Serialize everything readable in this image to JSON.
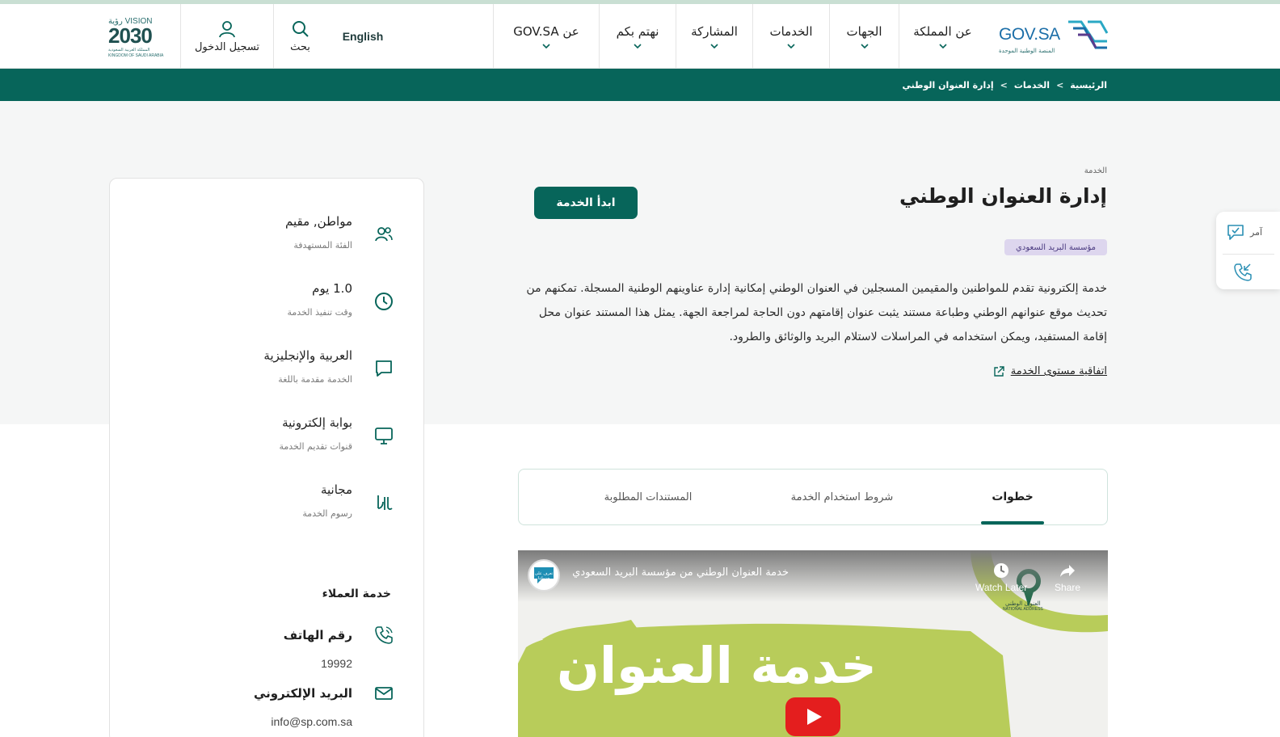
{
  "header": {
    "logo_text": "GOV.SA",
    "logo_subtitle": "المنصة الوطنية الموحدة",
    "nav": [
      {
        "label": "عن المملكة"
      },
      {
        "label": "الجهات"
      },
      {
        "label": "الخدمات"
      },
      {
        "label": "المشاركة"
      },
      {
        "label": "نهتم بكم"
      },
      {
        "label": "عن GOV.SA"
      }
    ],
    "language_label": "English",
    "search_label": "بحث",
    "login_label": "تسجيل الدخول",
    "vision_title": "VISION رؤية",
    "vision_year": "2030",
    "vision_sub": "المملكة العربية السعودية",
    "vision_sub_en": "KINGDOM OF SAUDI ARABIA"
  },
  "breadcrumb": {
    "items": [
      "الرئيسية",
      "الخدمات",
      "إدارة العنوان الوطني"
    ],
    "separator": ">"
  },
  "service": {
    "kicker": "الخدمة",
    "title": "إدارة العنوان الوطني",
    "start_button": "ابدأ الخدمة",
    "agency": "مؤسسة البريد السعودي",
    "description": "خدمة إلكترونية تقدم للمواطنين والمقيمين المسجلين في العنوان الوطني إمكانية إدارة عناوينهم الوطنية المسجلة. تمكنهم من تحديث موقع عنوانهم الوطني وطباعة مستند يثبت عنوان إقامتهم دون الحاجة لمراجعة الجهة. يمثل هذا المستند عنوان محل إقامة المستفيد، ويمكن استخدامه في المراسلات لاستلام البريد والوثائق والطرود.",
    "sla_link": "اتفاقية مستوى الخدمة"
  },
  "info": [
    {
      "value": "مواطن, مقيم",
      "caption": "الفئة المستهدفة",
      "icon": "users-icon"
    },
    {
      "value": "1.0 يوم",
      "caption": "وقت تنفيذ الخدمة",
      "icon": "clock-icon"
    },
    {
      "value": "العربية والإنجليزية",
      "caption": "الخدمة مقدمة باللغة",
      "icon": "chat-bubble-icon"
    },
    {
      "value": "بوابة إلكترونية",
      "caption": "قنوات تقديم الخدمة",
      "icon": "monitor-icon"
    },
    {
      "value": "مجانية",
      "caption": "رسوم الخدمة",
      "icon": "riyal-icon"
    }
  ],
  "customer_service": {
    "title": "خدمة العملاء",
    "phone_label": "رقم الهاتف",
    "phone_value": "19992",
    "email_label": "البريد الإلكتروني",
    "email_value": "info@sp.com.sa"
  },
  "tabs": [
    {
      "label": "خطوات",
      "active": true
    },
    {
      "label": "شروط استخدام الخدمة",
      "active": false
    },
    {
      "label": "المستندات المطلوبة",
      "active": false
    }
  ],
  "video": {
    "title": "خدمة العنوان الوطني من مؤسسة البريد السعودي",
    "watch_later": "Watch Later",
    "share": "Share",
    "overlay_text": "خدمة العنوان",
    "brand_ar": "العنوان الوطني",
    "brand_en": "NATIONAL ADDRESS",
    "channel_label": "تعرف على خدماتنا"
  },
  "float_widget": {
    "amer_label": "آمر"
  },
  "colors": {
    "brand_green": "#07655a",
    "agency_tag_bg": "#ddd6ee",
    "video_green": "#b8cc5a"
  }
}
